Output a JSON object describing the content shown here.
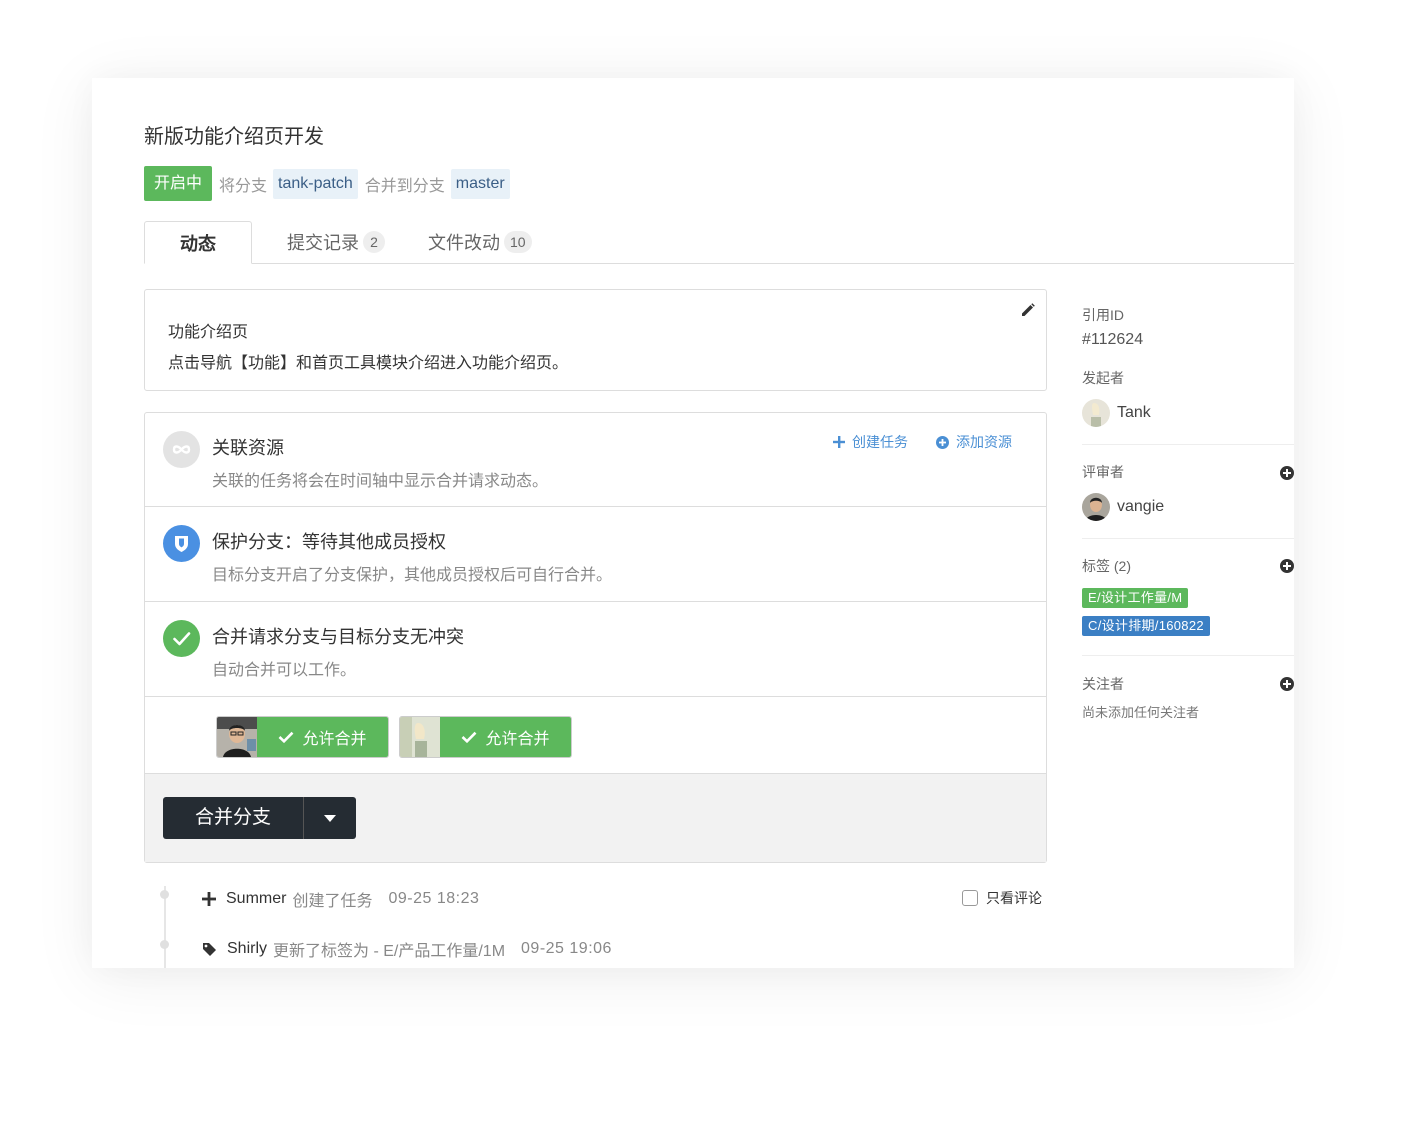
{
  "header": {
    "title": "新版功能介绍页开发",
    "status": "开启中",
    "from_text": "将分支",
    "source_branch": "tank-patch",
    "to_text": "合并到分支",
    "target_branch": "master"
  },
  "tabs": [
    {
      "label": "动态"
    },
    {
      "label": "提交记录",
      "count": "2"
    },
    {
      "label": "文件改动",
      "count": "10"
    }
  ],
  "description": {
    "title": "功能介绍页",
    "body": "点击导航【功能】和首页工具模块介绍进入功能介绍页。",
    "edit_icon": "pencil-icon"
  },
  "checks": {
    "resources": {
      "title": "关联资源",
      "subtitle": "关联的任务将会在时间轴中显示合并请求动态。",
      "create_task": "创建任务",
      "add_resource": "添加资源",
      "icon": "infinity-link-icon"
    },
    "protect": {
      "title": "保护分支：等待其他成员授权",
      "subtitle": "目标分支开启了分支保护，其他成员授权后可自行合并。",
      "icon": "shield-icon"
    },
    "conflict": {
      "title": "合并请求分支与目标分支无冲突",
      "subtitle": "自动合并可以工作。",
      "icon": "check-circle-icon"
    },
    "approvals": [
      {
        "label": "允许合并"
      },
      {
        "label": "允许合并"
      }
    ]
  },
  "merge": {
    "label": "合并分支"
  },
  "timeline": {
    "only_comments": "只看评论",
    "items": [
      {
        "user": "Summer",
        "action": "创建了任务",
        "time": "09-25 18:23",
        "icon": "plus-icon"
      },
      {
        "user": "Shirly",
        "action": "更新了标签为 - E/产品工作量/1M",
        "time": "09-25 19:06",
        "icon": "tag-icon"
      }
    ]
  },
  "sidebar": {
    "ref_label": "引用ID",
    "ref_value": "#112624",
    "author_label": "发起者",
    "author": "Tank",
    "reviewers_label": "评审者",
    "reviewer": "vangie",
    "tags_label": "标签 (2)",
    "tags": [
      {
        "text": "E/设计工作量/M",
        "color": "#5cb85c"
      },
      {
        "text": "C/设计排期/160822",
        "color": "#3b7fc4"
      }
    ],
    "watchers_label": "关注者",
    "watchers_empty": "尚未添加任何关注者"
  },
  "colors": {
    "success": "#5cb85c",
    "primary_blue": "#4a8fd4",
    "dark_button": "#252c33"
  }
}
